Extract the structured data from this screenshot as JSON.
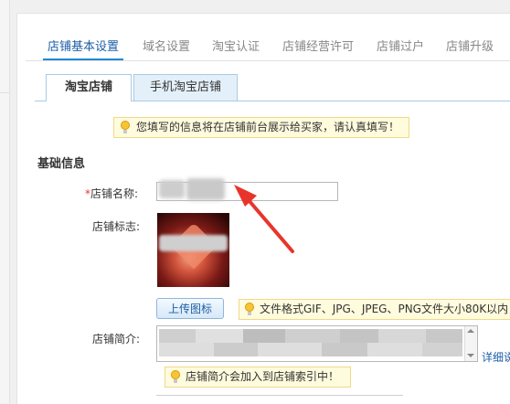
{
  "top_tabs": [
    {
      "label": "店铺基本设置",
      "active": true
    },
    {
      "label": "域名设置",
      "active": false
    },
    {
      "label": "淘宝认证",
      "active": false
    },
    {
      "label": "店铺经营许可",
      "active": false
    },
    {
      "label": "店铺过户",
      "active": false
    },
    {
      "label": "店铺升级",
      "active": false
    }
  ],
  "sub_tabs": [
    {
      "label": "淘宝店铺",
      "active": true
    },
    {
      "label": "手机淘宝店铺",
      "active": false
    }
  ],
  "notice_top": "您填写的信息将在店铺前台展示给买家，请认真填写！",
  "section_title": "基础信息",
  "form": {
    "shop_name_required": "*",
    "shop_name_label": "店铺名称:",
    "shop_logo_label": "店铺标志:",
    "upload_button": "上传图标",
    "file_hint": "文件格式GIF、JPG、JPEG、PNG文件大小80K以内，",
    "intro_label": "店铺简介:",
    "detail_link": "详细说",
    "intro_hint": "店铺简介会加入到店铺索引中！"
  },
  "colors": {
    "accent": "#1f8ad6",
    "link": "#1d5ea8",
    "notice_bg": "#fffbdd",
    "annotation_arrow": "#e8352b"
  }
}
